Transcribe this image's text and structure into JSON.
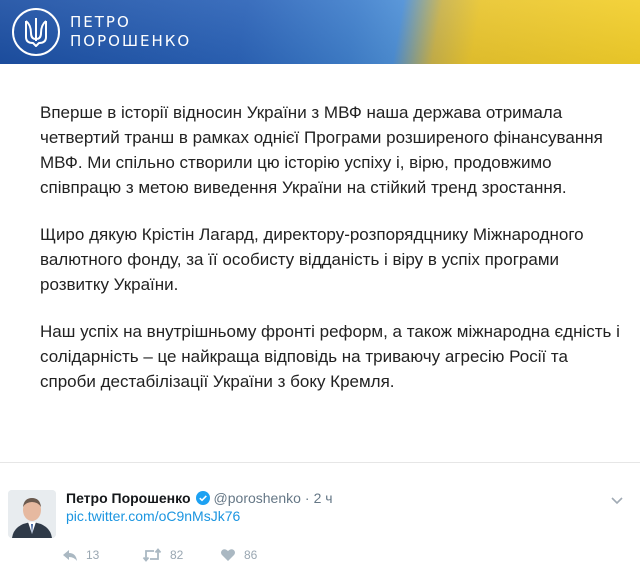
{
  "banner": {
    "name_line1": "ПЕТРО",
    "name_line2": "ПОРОШЕНКО",
    "emblem_icon": "trident-icon",
    "colors": {
      "blue": "#1c4fa3",
      "yellow": "#f3cf2a"
    }
  },
  "post": {
    "paragraphs": [
      "Вперше в історії відносин України з МВФ наша держава отримала четвертий транш в рамках однієї Програми розширеного фінансування МВФ. Ми спільно створили цю історію успіху і, вірю, продовжимо співпрацю з метою виведення України на стійкий тренд зростання.",
      "Щиро дякую Крістін Лагард, директору-розпорядцнику Міжнародного валютного фонду, за її особисту відданість і віру в успіх програми розвитку України.",
      "Наш успіх на внутрішньому фронті реформ, а також міжнародна єдність і солідарність – це найкраща відповідь на триваючу агресію Росії та спроби дестабілізації України з боку Кремля."
    ]
  },
  "tweet": {
    "name": "Петро Порошенко",
    "handle": "@poroshenko",
    "separator": "·",
    "time": "2 ч",
    "link": "pic.twitter.com/oC9nMsJk76",
    "actions": {
      "reply_count": "13",
      "retweet_count": "82",
      "like_count": "86"
    },
    "colors": {
      "link": "#1b95e0",
      "verified": "#1da1f2",
      "muted": "#657786"
    }
  }
}
